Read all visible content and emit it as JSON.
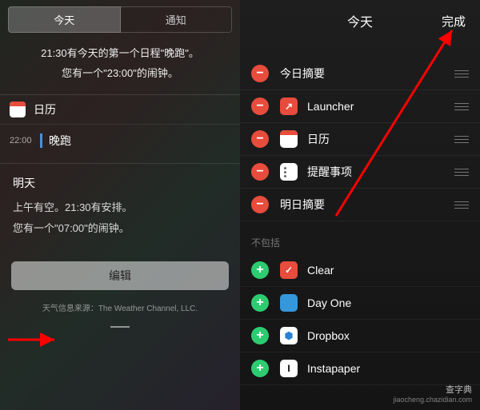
{
  "left": {
    "tabs": {
      "today": "今天",
      "notifications": "通知"
    },
    "summary_line1": "21:30有今天的第一个日程\"晚跑\"。",
    "summary_line2": "您有一个\"23:00\"的闹钟。",
    "calendar_section": "日历",
    "event": {
      "time": "22:00",
      "title": "晚跑"
    },
    "tomorrow": {
      "title": "明天",
      "line1": "上午有空。21:30有安排。",
      "line2": "您有一个\"07:00\"的闹钟。"
    },
    "edit_button": "编辑",
    "weather_credit": "天气信息来源：The Weather Channel, LLC."
  },
  "right": {
    "nav": {
      "title": "今天",
      "done": "完成"
    },
    "included": [
      {
        "name": "今日摘要",
        "icon": null
      },
      {
        "name": "Launcher",
        "icon": "launcher"
      },
      {
        "name": "日历",
        "icon": "calendar"
      },
      {
        "name": "提醒事项",
        "icon": "reminders"
      },
      {
        "name": "明日摘要",
        "icon": null
      }
    ],
    "excluded_header": "不包括",
    "excluded": [
      {
        "name": "Clear",
        "icon": "clear"
      },
      {
        "name": "Day One",
        "icon": "dayone"
      },
      {
        "name": "Dropbox",
        "icon": "dropbox"
      },
      {
        "name": "Instapaper",
        "icon": "instapaper"
      }
    ]
  },
  "watermark": {
    "main": "查字典",
    "sub": "jiaocheng.chazidian.com"
  }
}
